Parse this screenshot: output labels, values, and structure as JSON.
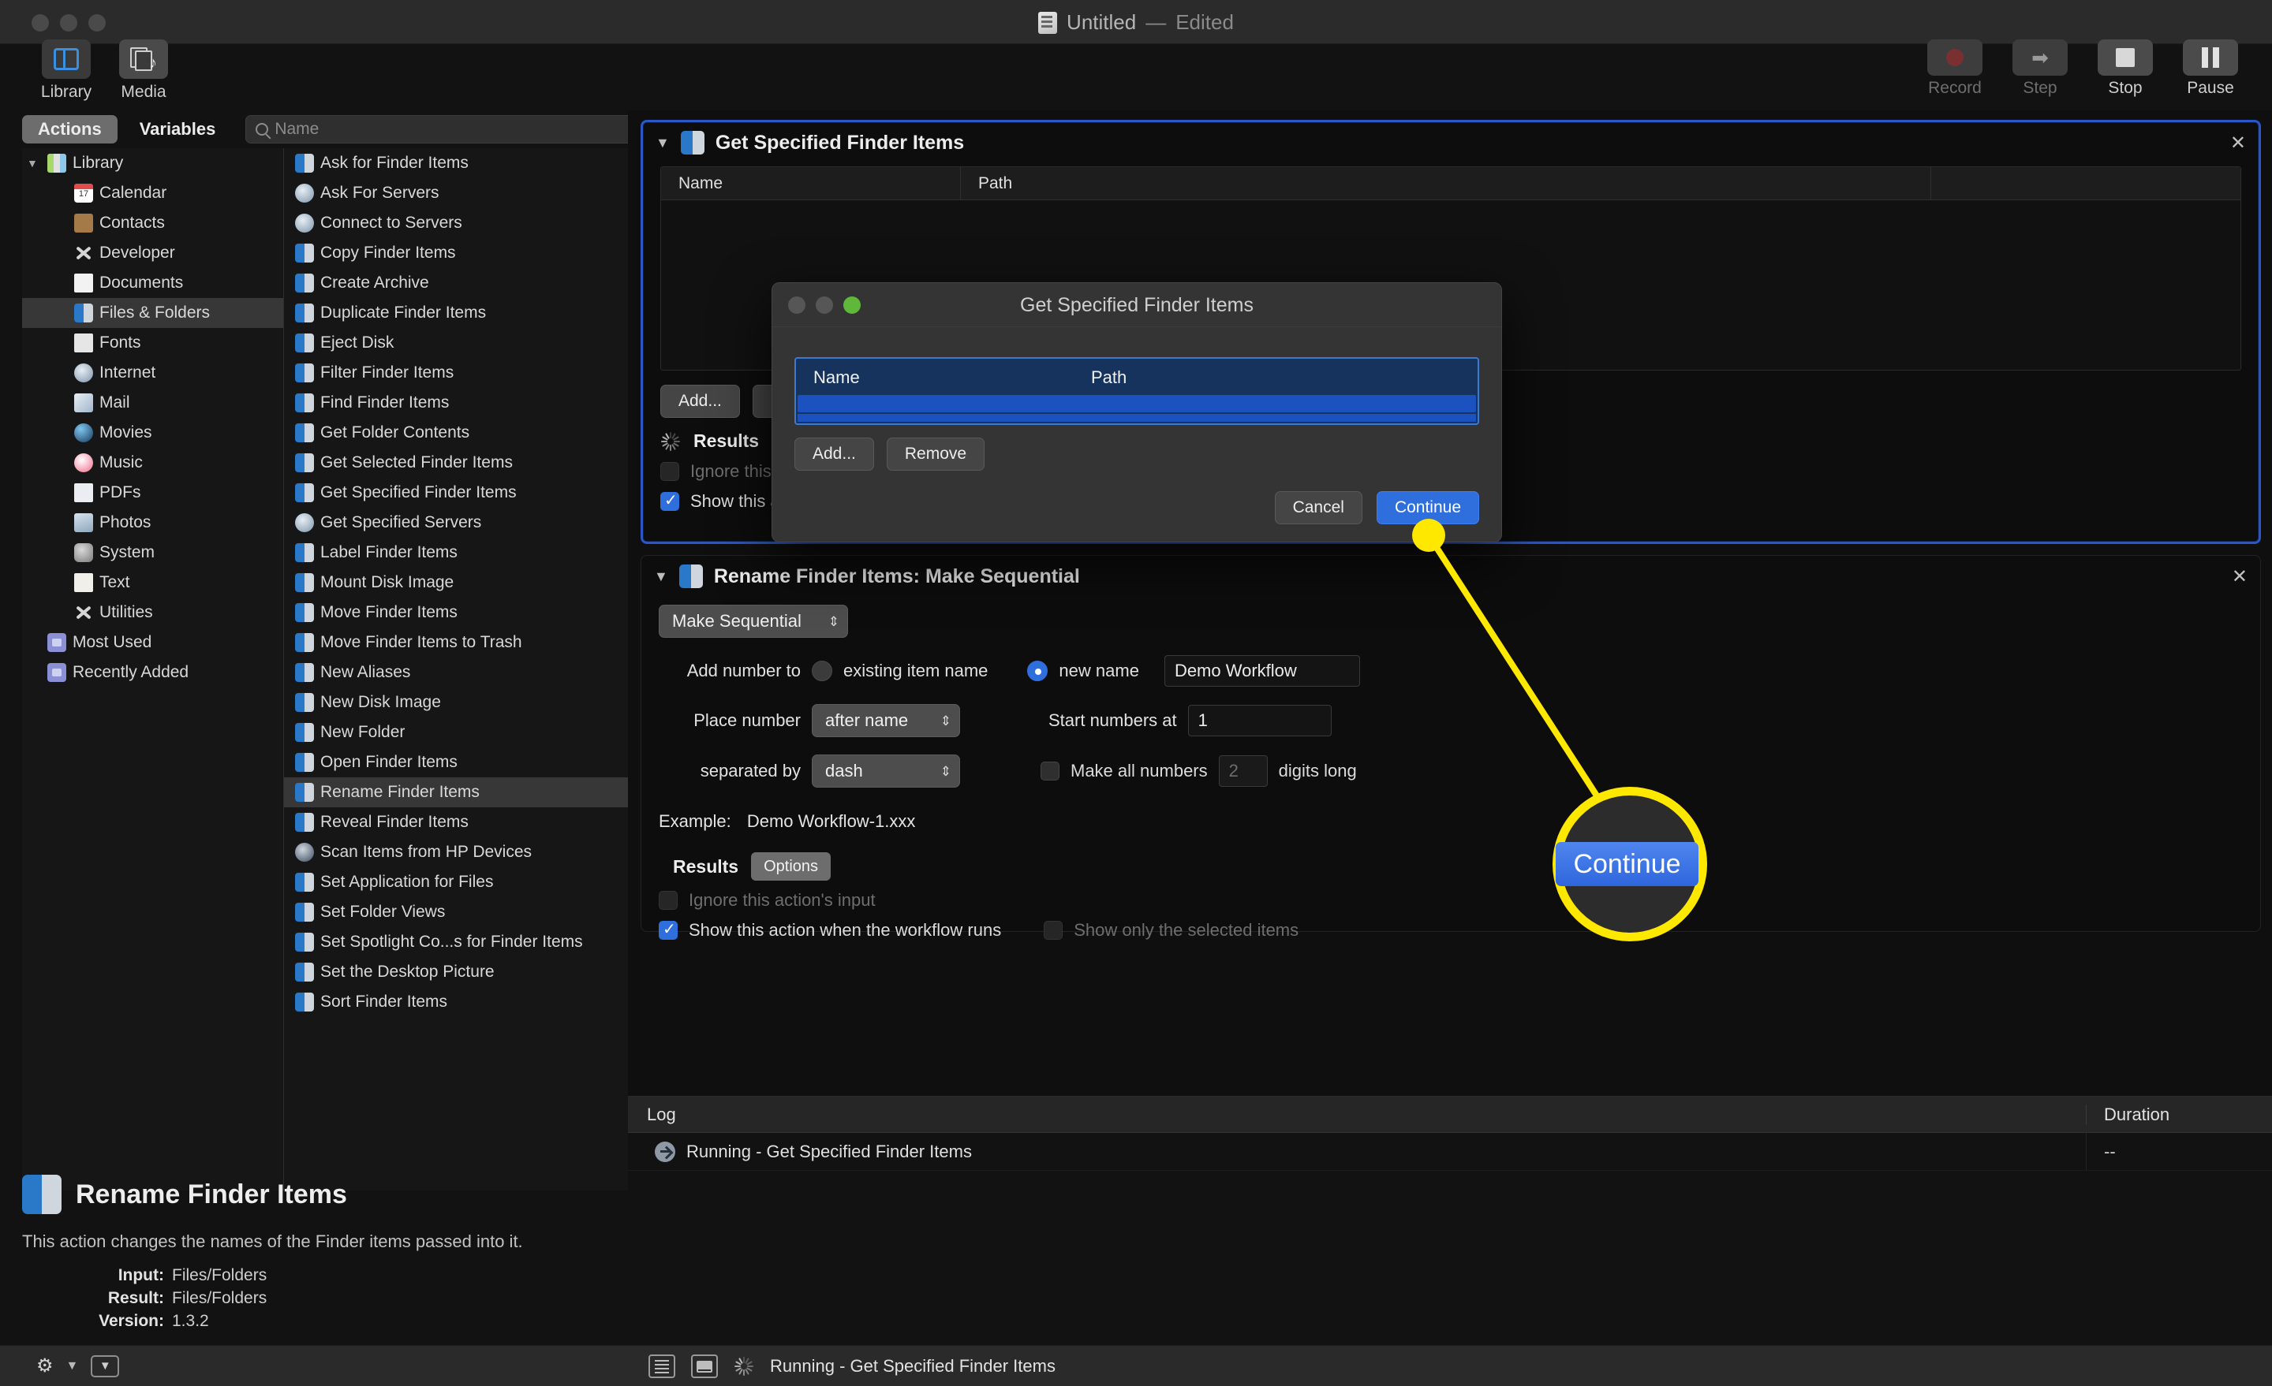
{
  "window": {
    "title": "Untitled",
    "title_separator": "—",
    "edited_label": "Edited"
  },
  "toolbar": {
    "left_items": [
      {
        "label": "Library",
        "icon": "library-icon",
        "selected": true
      },
      {
        "label": "Media",
        "icon": "media-icon",
        "selected": false
      }
    ],
    "right_items": [
      {
        "label": "Record",
        "icon": "record-icon",
        "enabled": false
      },
      {
        "label": "Step",
        "icon": "step-icon",
        "enabled": false
      },
      {
        "label": "Stop",
        "icon": "stop-icon",
        "enabled": true
      },
      {
        "label": "Pause",
        "icon": "pause-icon",
        "enabled": true
      }
    ]
  },
  "library_panel": {
    "tabs": [
      {
        "label": "Actions",
        "active": true
      },
      {
        "label": "Variables",
        "active": false
      }
    ],
    "search": {
      "placeholder": "Name",
      "value": "",
      "icon": "search-icon"
    },
    "categories": [
      {
        "label": "Library",
        "icon": "library-folder-icon",
        "level": 0,
        "expanded": true,
        "selected": false
      },
      {
        "label": "Calendar",
        "icon": "calendar-icon",
        "level": 1,
        "selected": false
      },
      {
        "label": "Contacts",
        "icon": "contacts-icon",
        "level": 1,
        "selected": false
      },
      {
        "label": "Developer",
        "icon": "developer-icon",
        "level": 1,
        "selected": false
      },
      {
        "label": "Documents",
        "icon": "documents-icon",
        "level": 1,
        "selected": false
      },
      {
        "label": "Files & Folders",
        "icon": "finder-icon",
        "level": 1,
        "selected": true
      },
      {
        "label": "Fonts",
        "icon": "fonts-icon",
        "level": 1,
        "selected": false
      },
      {
        "label": "Internet",
        "icon": "internet-icon",
        "level": 1,
        "selected": false
      },
      {
        "label": "Mail",
        "icon": "mail-icon",
        "level": 1,
        "selected": false
      },
      {
        "label": "Movies",
        "icon": "movies-icon",
        "level": 1,
        "selected": false
      },
      {
        "label": "Music",
        "icon": "music-icon",
        "level": 1,
        "selected": false
      },
      {
        "label": "PDFs",
        "icon": "pdf-icon",
        "level": 1,
        "selected": false
      },
      {
        "label": "Photos",
        "icon": "photos-icon",
        "level": 1,
        "selected": false
      },
      {
        "label": "System",
        "icon": "system-icon",
        "level": 1,
        "selected": false
      },
      {
        "label": "Text",
        "icon": "text-icon",
        "level": 1,
        "selected": false
      },
      {
        "label": "Utilities",
        "icon": "utilities-icon",
        "level": 1,
        "selected": false
      },
      {
        "label": "Most Used",
        "icon": "smart-folder-icon",
        "level": 0,
        "selected": false
      },
      {
        "label": "Recently Added",
        "icon": "smart-folder-icon",
        "level": 0,
        "selected": false
      }
    ],
    "actions": [
      {
        "label": "Ask for Finder Items",
        "icon": "finder-icon",
        "selected": false
      },
      {
        "label": "Ask For Servers",
        "icon": "internet-icon",
        "selected": false
      },
      {
        "label": "Connect to Servers",
        "icon": "internet-icon",
        "selected": false
      },
      {
        "label": "Copy Finder Items",
        "icon": "finder-icon",
        "selected": false
      },
      {
        "label": "Create Archive",
        "icon": "finder-icon",
        "selected": false
      },
      {
        "label": "Duplicate Finder Items",
        "icon": "finder-icon",
        "selected": false
      },
      {
        "label": "Eject Disk",
        "icon": "finder-icon",
        "selected": false
      },
      {
        "label": "Filter Finder Items",
        "icon": "finder-icon",
        "selected": false
      },
      {
        "label": "Find Finder Items",
        "icon": "finder-icon",
        "selected": false
      },
      {
        "label": "Get Folder Contents",
        "icon": "finder-icon",
        "selected": false
      },
      {
        "label": "Get Selected Finder Items",
        "icon": "finder-icon",
        "selected": false
      },
      {
        "label": "Get Specified Finder Items",
        "icon": "finder-icon",
        "selected": false
      },
      {
        "label": "Get Specified Servers",
        "icon": "internet-icon",
        "selected": false
      },
      {
        "label": "Label Finder Items",
        "icon": "finder-icon",
        "selected": false
      },
      {
        "label": "Mount Disk Image",
        "icon": "finder-icon",
        "selected": false
      },
      {
        "label": "Move Finder Items",
        "icon": "finder-icon",
        "selected": false
      },
      {
        "label": "Move Finder Items to Trash",
        "icon": "finder-icon",
        "selected": false
      },
      {
        "label": "New Aliases",
        "icon": "finder-icon",
        "selected": false
      },
      {
        "label": "New Disk Image",
        "icon": "finder-icon",
        "selected": false
      },
      {
        "label": "New Folder",
        "icon": "finder-icon",
        "selected": false
      },
      {
        "label": "Open Finder Items",
        "icon": "finder-icon",
        "selected": false
      },
      {
        "label": "Rename Finder Items",
        "icon": "finder-icon",
        "selected": true
      },
      {
        "label": "Reveal Finder Items",
        "icon": "finder-icon",
        "selected": false
      },
      {
        "label": "Scan Items from HP Devices",
        "icon": "hp-device-icon",
        "selected": false
      },
      {
        "label": "Set Application for Files",
        "icon": "finder-icon",
        "selected": false
      },
      {
        "label": "Set Folder Views",
        "icon": "finder-icon",
        "selected": false
      },
      {
        "label": "Set Spotlight Co...s for Finder Items",
        "icon": "finder-icon",
        "selected": false
      },
      {
        "label": "Set the Desktop Picture",
        "icon": "finder-icon",
        "selected": false
      },
      {
        "label": "Sort Finder Items",
        "icon": "finder-icon",
        "selected": false
      }
    ]
  },
  "info_panel": {
    "icon": "finder-icon",
    "title": "Rename Finder Items",
    "description": "This action changes the names of the Finder items passed into it.",
    "fields": [
      {
        "key": "Input:",
        "value": "Files/Folders"
      },
      {
        "key": "Result:",
        "value": "Files/Folders"
      },
      {
        "key": "Version:",
        "value": "1.3.2"
      }
    ]
  },
  "workflow": {
    "action_one": {
      "title": "Get Specified Finder Items",
      "icon": "finder-icon",
      "disclosure": "▼",
      "close": "✕",
      "table_headers": [
        "Name",
        "Path"
      ],
      "rows": [],
      "buttons": [
        "Add...",
        "Remove"
      ],
      "results_label": "Results",
      "checkbox_ignore": {
        "label": "Ignore this action's input",
        "checked": false,
        "enabled": false
      },
      "checkbox_show": {
        "label": "Show this action when the workflow runs",
        "checked": true,
        "enabled": true
      },
      "running": true
    },
    "action_two": {
      "title": "Rename Finder Items: Make Sequential",
      "icon": "finder-icon",
      "disclosure": "▼",
      "close": "✕",
      "mode_popup": {
        "value": "Make Sequential"
      },
      "add_number_to_label": "Add number to",
      "radio_existing": {
        "label": "existing item name",
        "selected": false
      },
      "radio_new": {
        "label": "new name",
        "selected": true
      },
      "new_name_field": {
        "value": "Demo Workflow"
      },
      "place_number_label": "Place number",
      "place_number_popup": {
        "value": "after name"
      },
      "start_numbers_label": "Start numbers at",
      "start_numbers_field": {
        "value": "1"
      },
      "separated_by_label": "separated by",
      "separated_by_popup": {
        "value": "dash"
      },
      "make_all_numbers": {
        "label_before": "Make all numbers",
        "digits": "2",
        "label_after": "digits long",
        "checked": false
      },
      "example_label": "Example:",
      "example_value": "Demo Workflow-1.xxx",
      "results_label": "Results",
      "options_button": "Options",
      "checkbox_ignore": {
        "label": "Ignore this action's input",
        "checked": false,
        "enabled": false
      },
      "checkbox_show": {
        "label": "Show this action when the workflow runs",
        "checked": true,
        "enabled": true
      },
      "checkbox_selected_only": {
        "label": "Show only the selected items",
        "checked": false,
        "enabled": false
      }
    }
  },
  "dialog": {
    "title": "Get Specified Finder Items",
    "traffic_lights": [
      "close-button",
      "minimize-button",
      "zoom-button"
    ],
    "table_headers": [
      "Name",
      "Path"
    ],
    "buttons": [
      "Add...",
      "Remove"
    ],
    "cancel_label": "Cancel",
    "continue_label": "Continue"
  },
  "log": {
    "headers": [
      "Log",
      "Duration"
    ],
    "rows": [
      {
        "message": "Running - Get Specified Finder Items",
        "duration": "--",
        "icon": "running-arrow-icon"
      }
    ]
  },
  "status_bar": {
    "gear_icon": "gear-icon",
    "chevron_icon": "chevron-down-icon",
    "toggle_icon": "disclosure-button-icon",
    "view_log_icon": "log-view-icon",
    "split_view_icon": "split-view-icon",
    "status_text": "Running - Get Specified Finder Items",
    "spinner_icon": "progress-spinner-icon"
  },
  "annotation": {
    "highlight_label": "Continue",
    "color": "#FFE800"
  }
}
